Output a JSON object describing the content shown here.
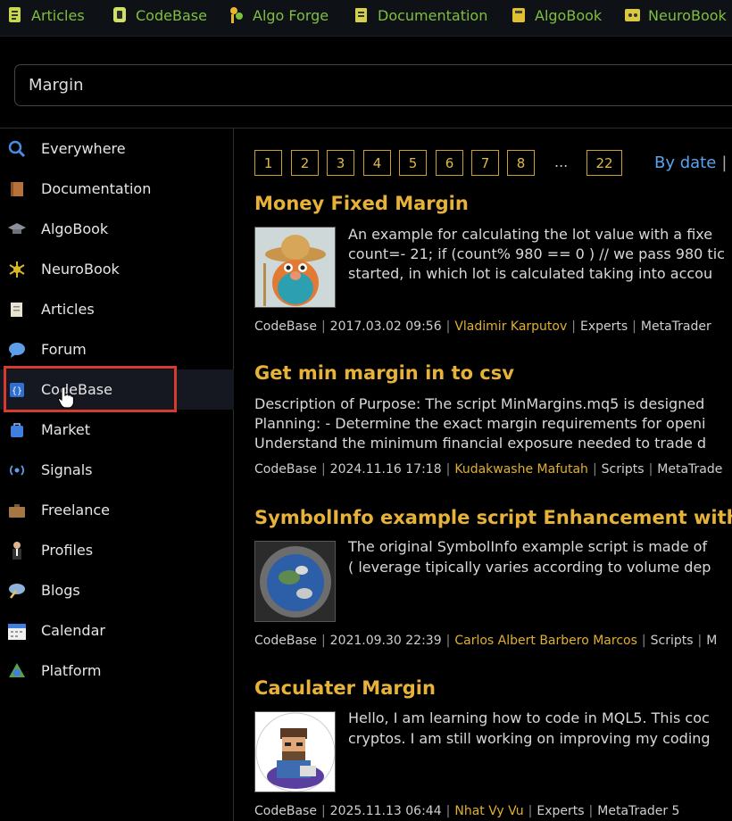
{
  "top_nav": {
    "items": [
      {
        "label": "Articles",
        "icon": "articles-icon"
      },
      {
        "label": "CodeBase",
        "icon": "codebase-icon"
      },
      {
        "label": "Algo Forge",
        "icon": "algo-forge-icon"
      },
      {
        "label": "Documentation",
        "icon": "documentation-icon"
      },
      {
        "label": "AlgoBook",
        "icon": "algobook-icon"
      },
      {
        "label": "NeuroBook",
        "icon": "neurobook-icon"
      }
    ]
  },
  "search": {
    "value": "Margin"
  },
  "sidebar": {
    "items": [
      {
        "label": "Everywhere",
        "icon": "search-icon"
      },
      {
        "label": "Documentation",
        "icon": "book-icon"
      },
      {
        "label": "AlgoBook",
        "icon": "graduation-cap-icon"
      },
      {
        "label": "NeuroBook",
        "icon": "neuron-icon"
      },
      {
        "label": "Articles",
        "icon": "document-icon"
      },
      {
        "label": "Forum",
        "icon": "speech-bubble-icon"
      },
      {
        "label": "CodeBase",
        "icon": "code-braces-icon"
      },
      {
        "label": "Market",
        "icon": "shopping-bag-icon"
      },
      {
        "label": "Signals",
        "icon": "signal-waves-icon"
      },
      {
        "label": "Freelance",
        "icon": "briefcase-icon"
      },
      {
        "label": "Profiles",
        "icon": "person-icon"
      },
      {
        "label": "Blogs",
        "icon": "pen-bubble-icon"
      },
      {
        "label": "Calendar",
        "icon": "calendar-icon"
      },
      {
        "label": "Platform",
        "icon": "platform-icon"
      }
    ],
    "active": "CodeBase"
  },
  "pagination": {
    "pages": [
      "1",
      "2",
      "3",
      "4",
      "5",
      "6",
      "7",
      "8"
    ],
    "ellipsis": "...",
    "last": "22"
  },
  "sort": {
    "label": "By date",
    "separator": "|"
  },
  "results": [
    {
      "title": "Money Fixed Margin",
      "desc": [
        "An example for calculating the lot value with a fixe",
        "count=- 21; if (count% 980 == 0 ) // we pass 980 tic",
        "started, in which lot is calculated taking into accou"
      ],
      "meta": {
        "source": "CodeBase",
        "date": "2017.03.02 09:56",
        "author": "Vladimir Karputov",
        "category": "Experts",
        "platform": "MetaTrader"
      }
    },
    {
      "title": "Get min margin in to csv",
      "desc": [
        "Description of Purpose: The script MinMargins.mq5 is designed",
        "Planning: - Determine the exact margin requirements for openi",
        "Understand the minimum financial exposure needed to trade d"
      ],
      "meta": {
        "source": "CodeBase",
        "date": "2024.11.16 17:18",
        "author": "Kudakwashe Mafutah",
        "category": "Scripts",
        "platform": "MetaTrade"
      }
    },
    {
      "title": "SymbolInfo example script Enhancement with mar",
      "desc": [
        "The original SymbolInfo example script is made of",
        "( leverage tipically varies according to volume dep"
      ],
      "meta": {
        "source": "CodeBase",
        "date": "2021.09.30 22:39",
        "author": "Carlos Albert Barbero Marcos",
        "category": "Scripts",
        "platform": "M"
      }
    },
    {
      "title": "Caculater Margin",
      "desc": [
        "Hello, I am learning how to code in MQL5. This coc",
        "cryptos. I am still working on improving my coding"
      ],
      "meta": {
        "source": "CodeBase",
        "date": "2025.11.13 06:44",
        "author": "Nhat Vy Vu",
        "category": "Experts",
        "platform": "MetaTrader 5"
      }
    }
  ]
}
